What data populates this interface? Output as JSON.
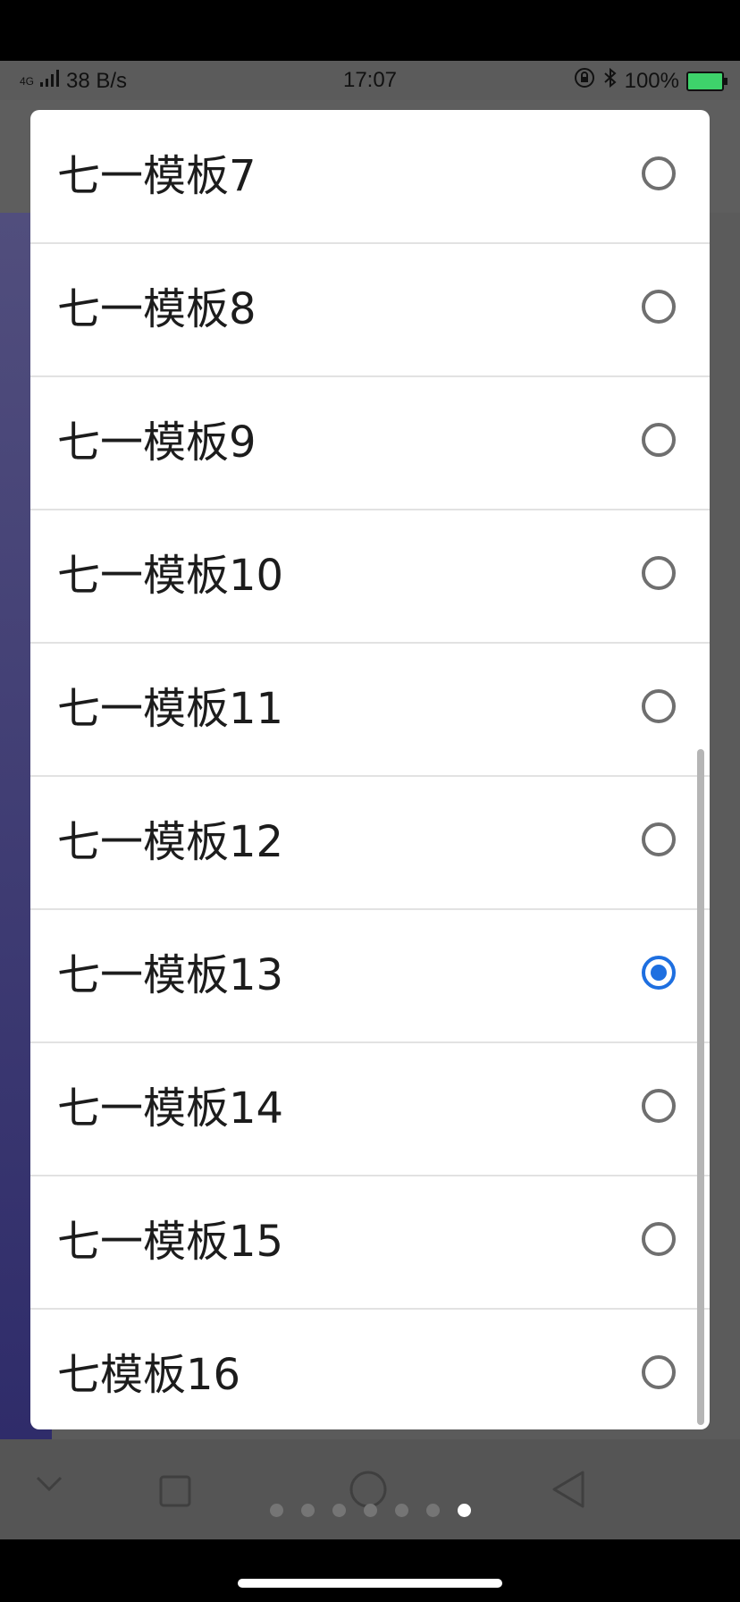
{
  "status_bar": {
    "network_type": "4G",
    "speed": "38 B/s",
    "time": "17:07",
    "battery": "100%"
  },
  "dialog": {
    "items": [
      {
        "label": "七一模板7",
        "selected": false
      },
      {
        "label": "七一模板8",
        "selected": false
      },
      {
        "label": "七一模板9",
        "selected": false
      },
      {
        "label": "七一模板10",
        "selected": false
      },
      {
        "label": "七一模板11",
        "selected": false
      },
      {
        "label": "七一模板12",
        "selected": false
      },
      {
        "label": "七一模板13",
        "selected": true
      },
      {
        "label": "七一模板14",
        "selected": false
      },
      {
        "label": "七一模板15",
        "selected": false
      },
      {
        "label": "七模板16",
        "selected": false
      }
    ]
  },
  "pager": {
    "page_count": 7,
    "active_index": 6
  },
  "colors": {
    "accent": "#1e6fe0",
    "radio_off": "#6f6f6f"
  }
}
